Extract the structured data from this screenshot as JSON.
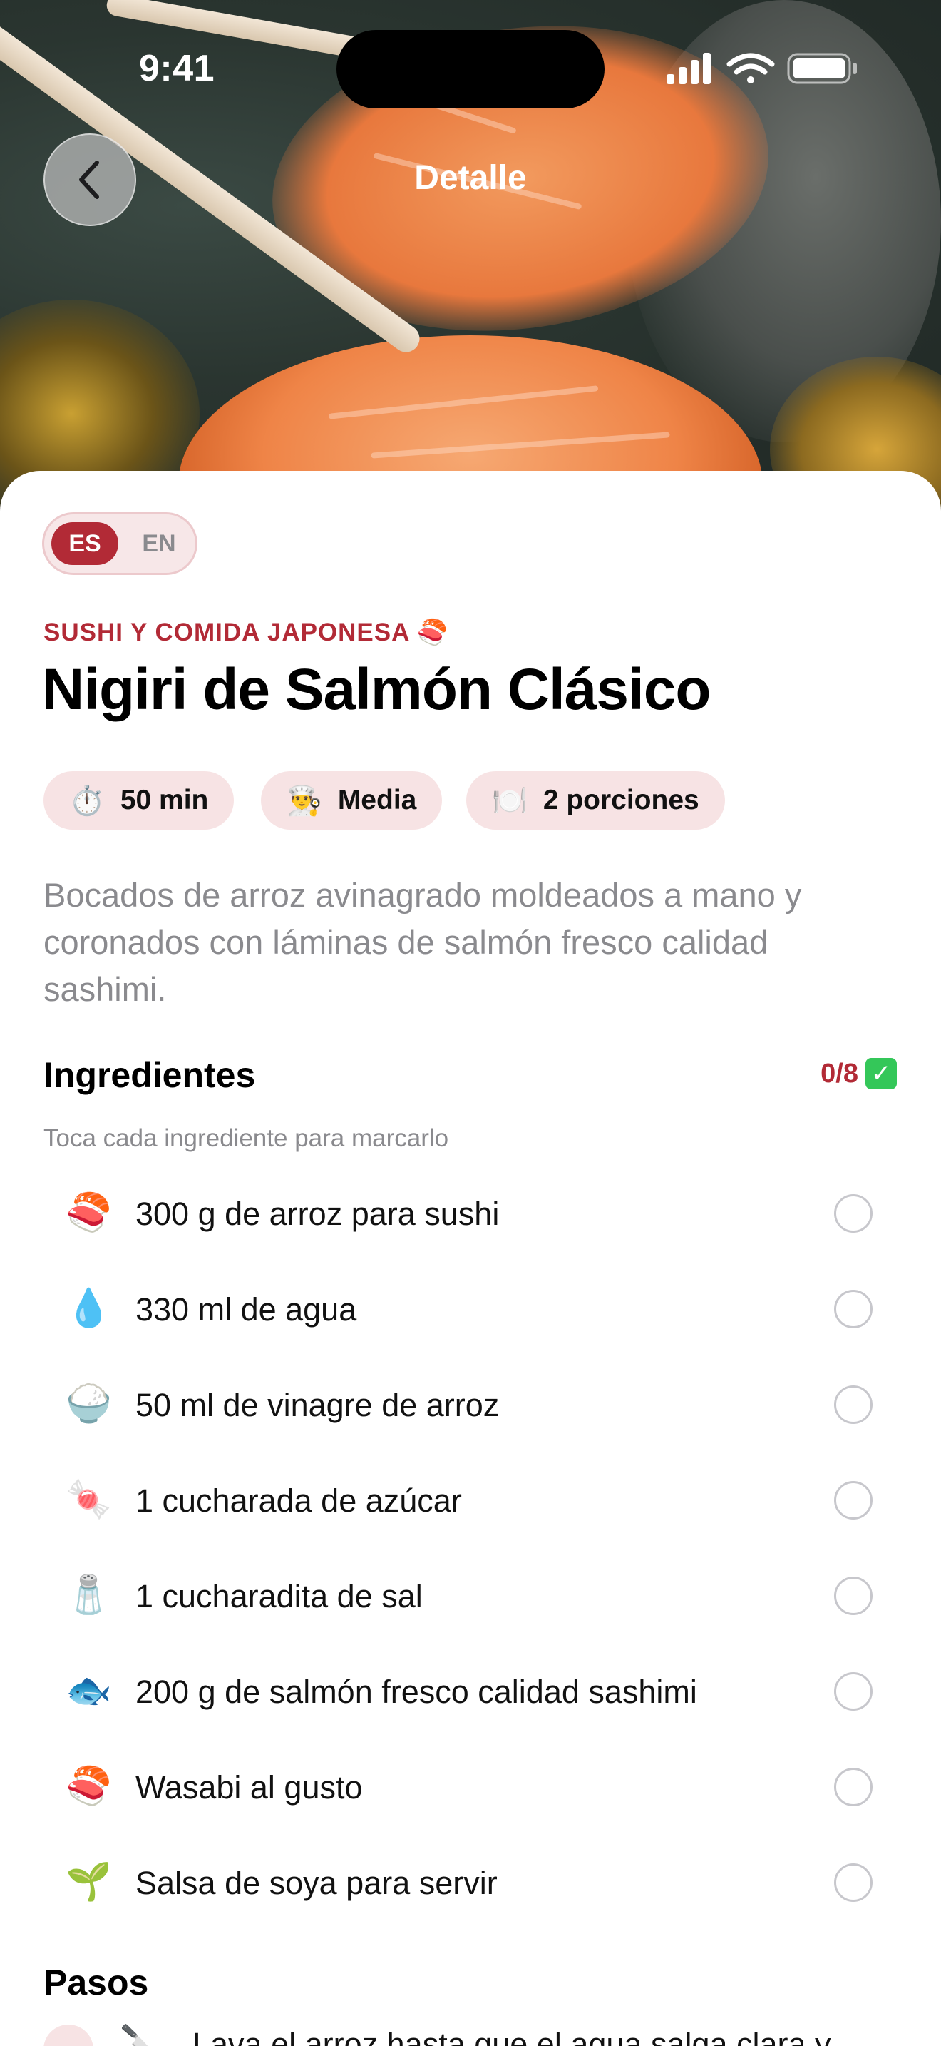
{
  "status_bar": {
    "time": "9:41"
  },
  "nav": {
    "title": "Detalle",
    "back_icon": "chevron-left-icon"
  },
  "language": {
    "options": [
      "ES",
      "EN"
    ],
    "selected": "ES"
  },
  "recipe": {
    "category": "SUSHI Y COMIDA JAPONESA 🍣",
    "title": "Nigiri de Salmón Clásico",
    "chips": [
      {
        "icon": "⏱️",
        "label": "50 min"
      },
      {
        "icon": "👨‍🍳",
        "label": "Media"
      },
      {
        "icon": "🍽️",
        "label": "2 porciones"
      }
    ],
    "description": "Bocados de arroz avinagrado moldeados a mano y coronados con láminas de salmón fresco calidad sashimi."
  },
  "ingredients": {
    "title": "Ingredientes",
    "counter": "0/8",
    "counter_icon": "✓",
    "hint": "Toca cada ingrediente para marcarlo",
    "items": [
      {
        "icon": "🍣",
        "label": "300 g de arroz para sushi",
        "checked": false
      },
      {
        "icon": "💧",
        "label": "330 ml de agua",
        "checked": false
      },
      {
        "icon": "🍚",
        "label": "50 ml de vinagre de arroz",
        "checked": false
      },
      {
        "icon": "🍬",
        "label": "1 cucharada de azúcar",
        "checked": false
      },
      {
        "icon": "🧂",
        "label": "1 cucharadita de sal",
        "checked": false
      },
      {
        "icon": "🐟",
        "label": "200 g de salmón fresco calidad sashimi",
        "checked": false
      },
      {
        "icon": "🍣",
        "label": "Wasabi al gusto",
        "checked": false
      },
      {
        "icon": "🌱",
        "label": "Salsa de soya para servir",
        "checked": false
      }
    ]
  },
  "steps": {
    "title": "Pasos",
    "first_icon": "🔪",
    "first_text": "Lava el arroz hasta que el agua salga clara y"
  },
  "colors": {
    "accent": "#b22a36",
    "chip_bg": "#f7e3e4",
    "muted": "#8a8a8e"
  }
}
